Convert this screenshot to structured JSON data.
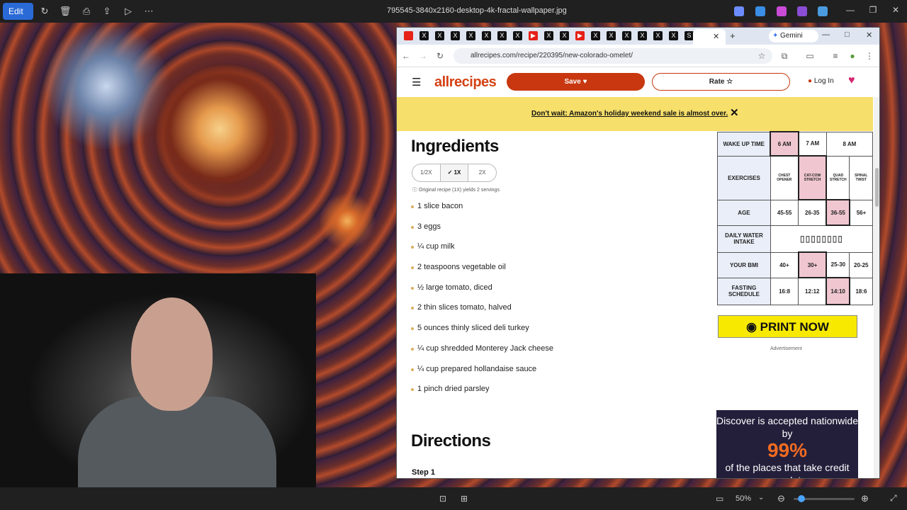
{
  "photos_app": {
    "edit_label": "Edit",
    "title": "795545-3840x2160-desktop-4k-fractal-wallpaper.jpg",
    "zoom": "50%"
  },
  "browser": {
    "gemini_label": "Gemini",
    "url": "allrecipes.com/recipe/220395/new-colorado-omelet/"
  },
  "site": {
    "logo": "allrecipes",
    "save_label": "Save",
    "rate_label": "Rate",
    "login_label": "Log In",
    "banner_text": "Don't wait: Amazon's holiday weekend sale is almost over."
  },
  "recipe": {
    "ingredients_heading": "Ingredients",
    "scale_options": [
      "1/2X",
      "✓ 1X",
      "2X"
    ],
    "original_note": "Original recipe (1X) yields 2 servings",
    "ingredients": [
      "1 slice bacon",
      "3 eggs",
      "¼ cup milk",
      "2 teaspoons vegetable oil",
      "½ large tomato, diced",
      "2 thin slices tomato, halved",
      "5 ounces thinly sliced deli turkey",
      "¼ cup shredded Monterey Jack cheese",
      "¼ cup prepared hollandaise sauce",
      "1 pinch dried parsley"
    ],
    "directions_heading": "Directions",
    "step_label": "Step 1"
  },
  "ad": {
    "rows": [
      {
        "label": "WAKE UP TIME",
        "cells": [
          "6 AM",
          "7 AM",
          "8 AM"
        ]
      },
      {
        "label": "EXERCISES",
        "cells": [
          "CHEST OPENER",
          "CAT-COW STRETCH",
          "QUAD STRETCH",
          "SPINAL TWIST"
        ]
      },
      {
        "label": "AGE",
        "cells": [
          "45-55",
          "26-35",
          "36-55",
          "56+"
        ]
      },
      {
        "label": "DAILY WATER INTAKE",
        "cells": []
      },
      {
        "label": "YOUR BMI",
        "cells": [
          "40+",
          "30+",
          "25-30",
          "20-25"
        ]
      },
      {
        "label": "FASTING SCHEDULE",
        "cells": [
          "16:8",
          "12:12",
          "14:10",
          "18:6"
        ]
      }
    ],
    "print_label": "PRINT NOW",
    "advertisement_label": "Advertisement",
    "discover_line1": "Discover is accepted nationwide by",
    "discover_big": "99%",
    "discover_line2": "of the places that take credit cards*"
  }
}
